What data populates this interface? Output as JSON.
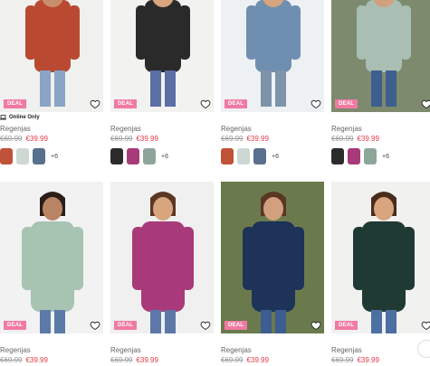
{
  "badge": "DEAL",
  "online_only": "Online Only",
  "products": [
    {
      "name": "Regenjas",
      "old_price": "€69.99",
      "new_price": "€39.99",
      "colors": [
        "#c1523a",
        "#cdd8d3",
        "#58708d"
      ],
      "more": "+6",
      "scene": {
        "bg": "#f0f0ee",
        "coat": "#b94a31",
        "pants": "#8aa4c8",
        "skin": "#c98f6d",
        "hair": "#6a3f26"
      }
    },
    {
      "name": "Regenjas",
      "old_price": "€69.99",
      "new_price": "€39.99",
      "colors": [
        "#2b2b2b",
        "#a83a79",
        "#8ea69a"
      ],
      "more": "+6",
      "scene": {
        "bg": "#f2f2f1",
        "coat": "#2a2a2a",
        "pants": "#5b6ea6",
        "skin": "#d8a57f",
        "hair": "#3a2519"
      }
    },
    {
      "name": "Regenjas",
      "old_price": "€69.99",
      "new_price": "€39.99",
      "colors": [
        "#c1523a",
        "#cdd8d3",
        "#58708d"
      ],
      "more": "+6",
      "scene": {
        "bg": "#eef1f3",
        "coat": "#6f8fb0",
        "pants": "#7f93aa",
        "skin": "#d8a57f",
        "hair": "#7a5132"
      }
    },
    {
      "name": "Regenjas",
      "old_price": "€69.99",
      "new_price": "€39.99",
      "colors": [
        "#2b2b2b",
        "#a83a79",
        "#8ea69a"
      ],
      "more": "+6",
      "scene": {
        "bg": "#7d8a6e",
        "coat": "#a9bfb4",
        "pants": "#3e5f8d",
        "skin": "#d2a07f",
        "hair": "#3a2519"
      }
    },
    {
      "name": "Regenjas",
      "old_price": "€69.99",
      "new_price": "€39.99",
      "scene": {
        "bg": "#f2f2f2",
        "coat": "#a7c3b2",
        "pants": "#5c7aa8",
        "skin": "#b98464",
        "hair": "#2b1e17"
      }
    },
    {
      "name": "Regenjas",
      "old_price": "€69.99",
      "new_price": "€39.99",
      "scene": {
        "bg": "#f0f0f0",
        "coat": "#a83a79",
        "pants": "#5d78a8",
        "skin": "#d8a57f",
        "hair": "#5a3722"
      }
    },
    {
      "name": "Regenjas",
      "old_price": "€69.99",
      "new_price": "€39.99",
      "scene": {
        "bg": "#6b7a4c",
        "coat": "#1d3358",
        "pants": "#3b5d8f",
        "skin": "#d2a07f",
        "hair": "#5a3722"
      }
    },
    {
      "name": "Regenjas",
      "old_price": "€69.99",
      "new_price": "€39.99",
      "scene": {
        "bg": "#f1f1f0",
        "coat": "#1f3a33",
        "pants": "#4d6fa2",
        "skin": "#d8a57f",
        "hair": "#4a2c1d"
      }
    }
  ]
}
